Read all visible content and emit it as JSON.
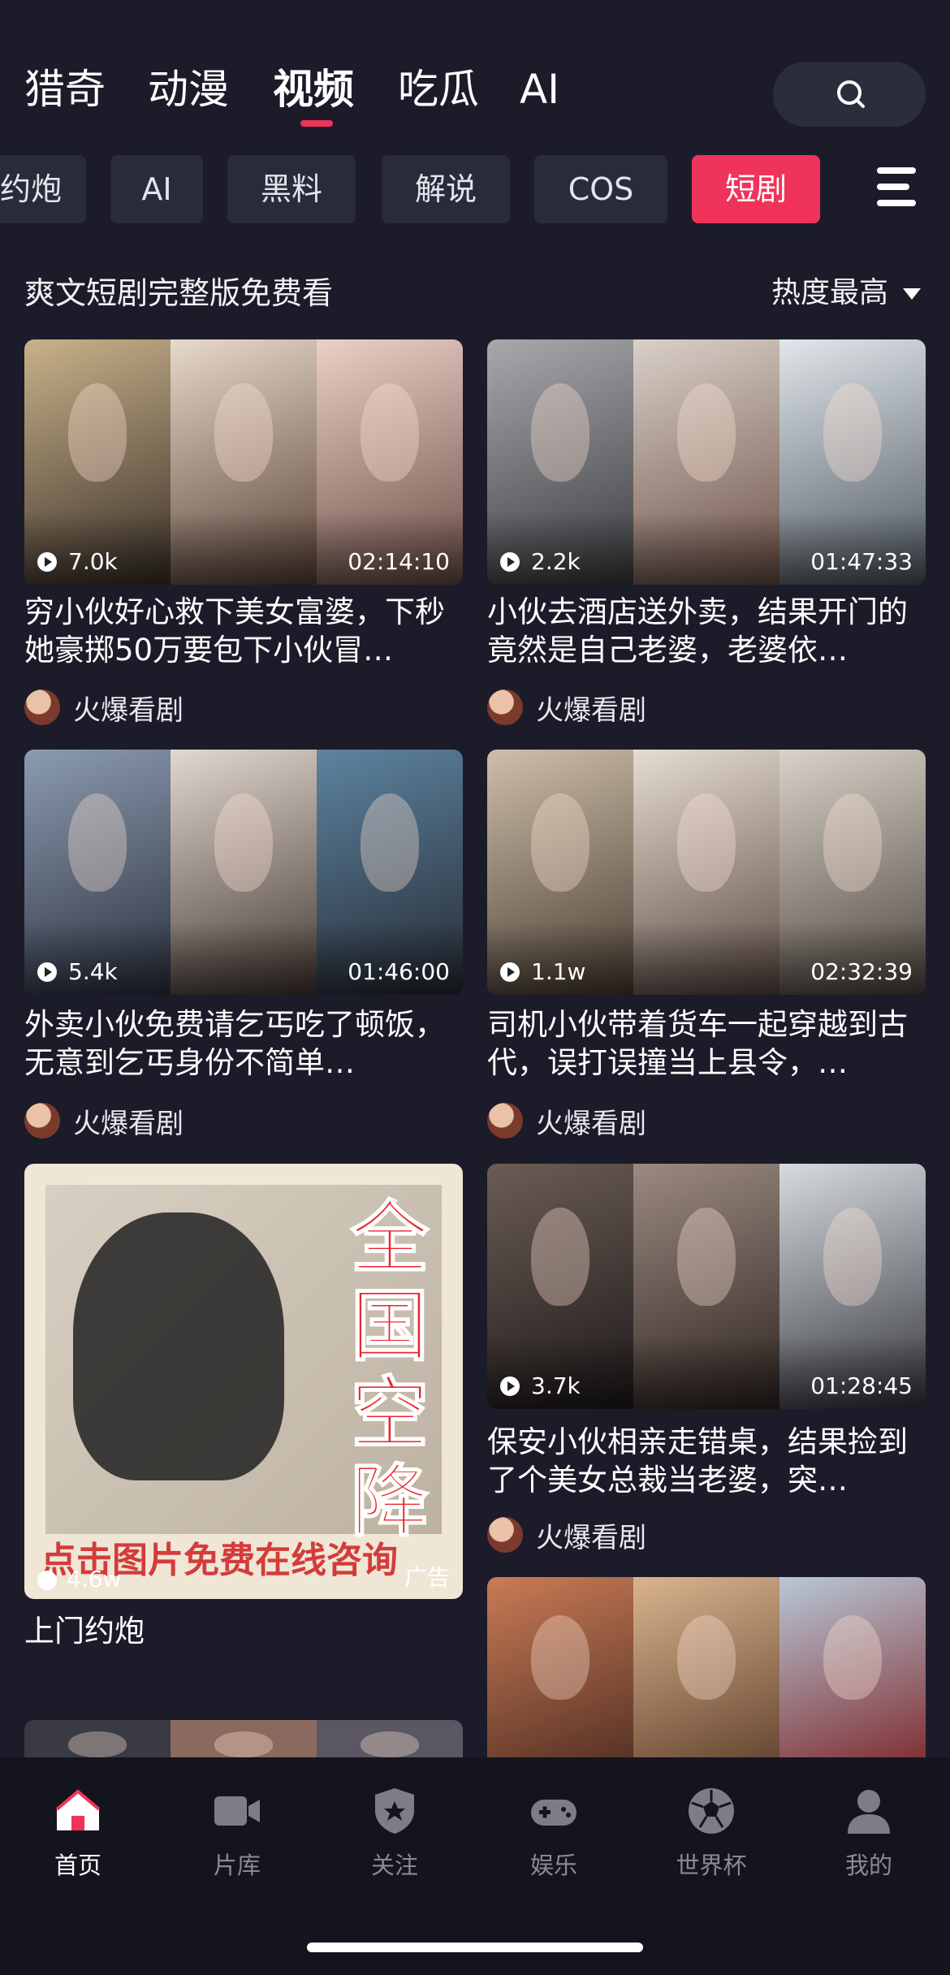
{
  "top_tabs": [
    {
      "label": "猎奇"
    },
    {
      "label": "动漫"
    },
    {
      "label": "视频"
    },
    {
      "label": "吃瓜"
    },
    {
      "label": "AI"
    }
  ],
  "active_top_tab": "视频",
  "categories": [
    {
      "label": "约炮"
    },
    {
      "label": "AI"
    },
    {
      "label": "黑料"
    },
    {
      "label": "解说"
    },
    {
      "label": "COS"
    },
    {
      "label": "短剧"
    }
  ],
  "active_category": "短剧",
  "section": {
    "title": "爽文短剧完整版免费看",
    "sort_label": "热度最高"
  },
  "videos": [
    {
      "views": "7.0k",
      "duration": "02:14:10",
      "title": "穷小伙好心救下美女富婆，下秒她豪掷50万要包下小伙冒…",
      "author": "火爆看剧"
    },
    {
      "views": "2.2k",
      "duration": "01:47:33",
      "title": "小伙去酒店送外卖，结果开门的竟然是自己老婆，老婆依…",
      "author": "火爆看剧"
    },
    {
      "views": "5.4k",
      "duration": "01:46:00",
      "title": "外卖小伙免费请乞丐吃了顿饭，无意到乞丐身份不简单…",
      "author": "火爆看剧"
    },
    {
      "views": "1.1w",
      "duration": "02:32:39",
      "title": "司机小伙带着货车一起穿越到古代，误打误撞当上县令，…",
      "author": "火爆看剧"
    },
    {
      "views": "3.7k",
      "duration": "01:28:45",
      "title": "保安小伙相亲走错桌，结果捡到了个美女总裁当老婆，突…",
      "author": "火爆看剧"
    }
  ],
  "ad": {
    "big_text": "全国空降",
    "promo_text": "点击图片免费在线咨询",
    "views": "4.6w",
    "label": "广告",
    "title": "上门约炮"
  },
  "bottom_nav": [
    {
      "label": "首页"
    },
    {
      "label": "片库"
    },
    {
      "label": "关注"
    },
    {
      "label": "娱乐"
    },
    {
      "label": "世界杯"
    },
    {
      "label": "我的"
    }
  ],
  "colors": {
    "accent": "#f0335a",
    "background": "#1c1b29",
    "chip": "#2a2b3a",
    "nav_bar": "#14141f"
  }
}
